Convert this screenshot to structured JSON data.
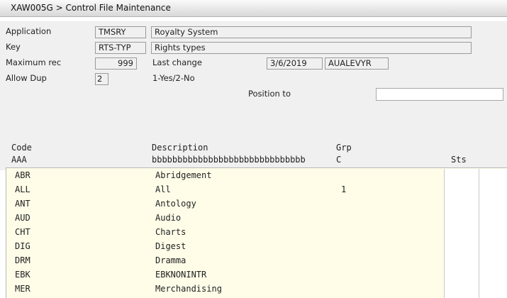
{
  "window": {
    "title": "XAW005G > Control File Maintenance"
  },
  "form": {
    "application_label": "Application",
    "application_code": "TMSRY",
    "application_name": "Royalty System",
    "key_label": "Key",
    "key_code": "RTS-TYP",
    "key_name": "Rights types",
    "max_rec_label": "Maximum rec",
    "max_rec_value": "999",
    "last_change_label": "Last change",
    "last_change_date": "3/6/2019",
    "last_change_user": "AUALEVYR",
    "allow_dup_label": "Allow Dup",
    "allow_dup_value": "2",
    "allow_dup_hint": "1-Yes/2-No",
    "position_to_label": "Position to",
    "position_to_value": ""
  },
  "table": {
    "headers": {
      "code": "Code",
      "description": "Description",
      "grp": "Grp",
      "sts": "Sts"
    },
    "subheaders": {
      "code": "AAA",
      "description": "bbbbbbbbbbbbbbbbbbbbbbbbbbbbbb",
      "grp": "C"
    },
    "rows": [
      {
        "code": "ABR",
        "description": "Abridgement",
        "grp": ""
      },
      {
        "code": "ALL",
        "description": "All",
        "grp": "1"
      },
      {
        "code": "ANT",
        "description": "Antology",
        "grp": ""
      },
      {
        "code": "AUD",
        "description": "Audio",
        "grp": ""
      },
      {
        "code": "CHT",
        "description": "Charts",
        "grp": ""
      },
      {
        "code": "DIG",
        "description": "Digest",
        "grp": ""
      },
      {
        "code": "DRM",
        "description": "Dramma",
        "grp": ""
      },
      {
        "code": "EBK",
        "description": "EBKNONINTR",
        "grp": ""
      },
      {
        "code": "MER",
        "description": "Merchandising",
        "grp": ""
      }
    ]
  }
}
